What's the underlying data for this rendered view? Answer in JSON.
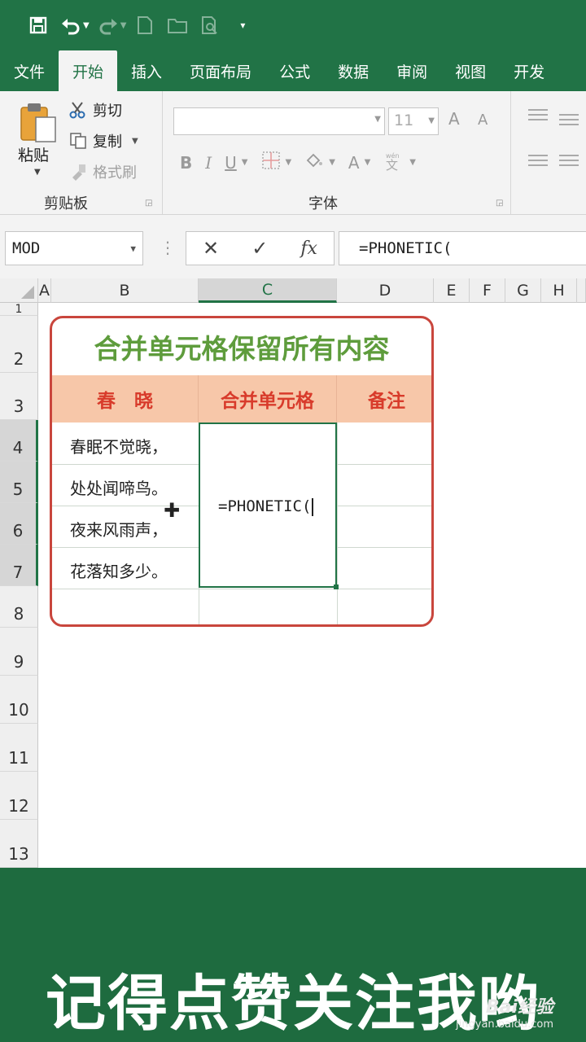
{
  "quick_access": {
    "icons": [
      "save-icon",
      "undo-icon",
      "redo-icon",
      "new-file-icon",
      "open-folder-icon",
      "print-preview-icon",
      "customize-icon"
    ]
  },
  "tabs": [
    "文件",
    "开始",
    "插入",
    "页面布局",
    "公式",
    "数据",
    "审阅",
    "视图",
    "开发"
  ],
  "active_tab": "开始",
  "ribbon": {
    "clipboard": {
      "paste": "粘贴",
      "cut": "剪切",
      "copy": "复制",
      "format_painter": "格式刷",
      "label": "剪贴板"
    },
    "font": {
      "font_name": "",
      "font_size": "11",
      "bold": "B",
      "italic": "I",
      "underline": "U",
      "font_color": "A",
      "phonetic": "wén",
      "grow": "A",
      "shrink": "A",
      "label": "字体"
    }
  },
  "formula_bar": {
    "name_box": "MOD",
    "cancel": "✕",
    "enter": "✓",
    "fx": "fx",
    "formula": "=PHONETIC("
  },
  "sheet": {
    "columns": [
      "A",
      "B",
      "C",
      "D",
      "E",
      "F",
      "G",
      "H"
    ],
    "selected_column": "C",
    "rows": [
      "1",
      "2",
      "3",
      "4",
      "5",
      "6",
      "7",
      "8",
      "9",
      "10",
      "11",
      "12",
      "13"
    ],
    "selected_rows": [
      "4",
      "5",
      "6",
      "7"
    ],
    "card": {
      "title": "合并单元格保留所有内容",
      "headers": [
        "春　晓",
        "合并单元格",
        "备注"
      ],
      "poem_lines": [
        "春眠不觉晓，",
        "处处闻啼鸟。",
        "夜来风雨声，",
        "花落知多少。"
      ],
      "editing_cell_text": "=PHONETIC("
    }
  },
  "banner": {
    "text": "记得点赞关注我哟",
    "watermark_logo": "Bai经验",
    "watermark_url": "jingyan.baidu.com"
  },
  "colors": {
    "excel_green": "#217346",
    "title_green": "#5e9c3c",
    "header_red": "#d83b2b",
    "header_fill": "#f7c7a9",
    "card_border": "#c9463d",
    "banner_green": "#1e6b3f"
  }
}
